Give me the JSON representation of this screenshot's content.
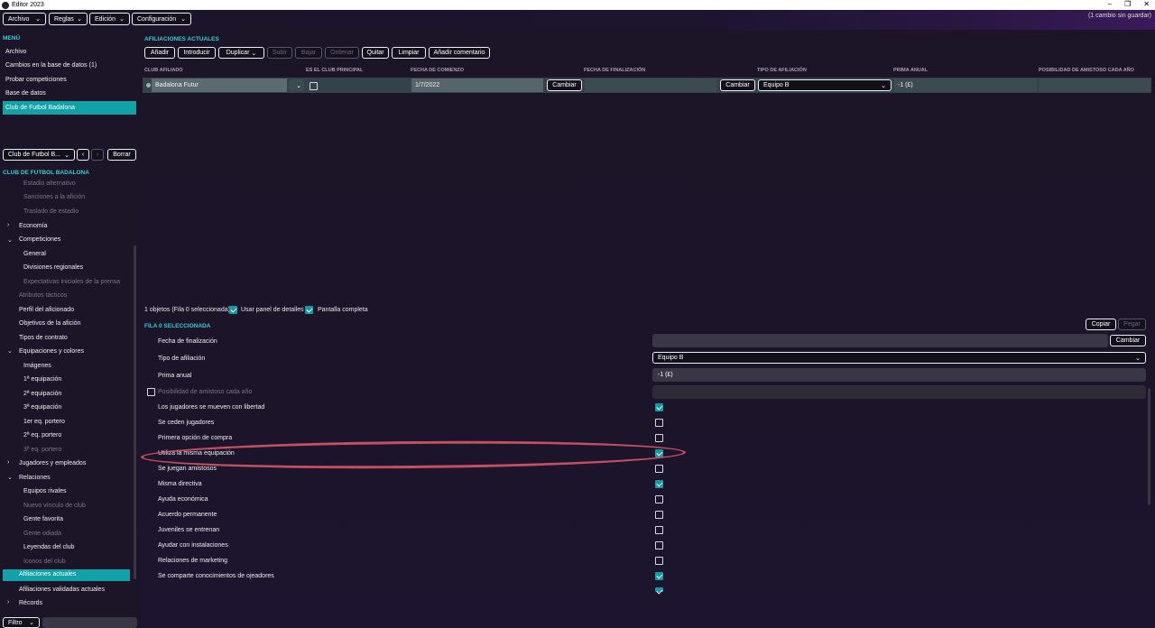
{
  "window": {
    "title": "Editor 2023",
    "controls": [
      "–",
      "❐",
      "✕"
    ]
  },
  "menubar": [
    {
      "label": "Archivo"
    },
    {
      "label": "Reglas"
    },
    {
      "label": "Edición"
    },
    {
      "label": "Configuración"
    }
  ],
  "unsaved": "(1 cambio sin guardar)",
  "left": {
    "menu_title": "MENÚ",
    "menu_items": [
      "Archivo",
      "Cambios en la base de datos (1)",
      "Probar competiciones",
      "Base de datos",
      "Club de Futbol Badalona"
    ],
    "selector": "Club de Futbol B...",
    "delete": "Borrar",
    "club_title": "CLUB DE FUTBOL BADALONA",
    "tree": [
      {
        "label": "Estadio alternativo",
        "dim": true
      },
      {
        "label": "Sanciones a la afición",
        "dim": true
      },
      {
        "label": "Traslado de estadio",
        "dim": true
      },
      {
        "label": "Economía"
      },
      {
        "label": "Competiciones"
      },
      {
        "label": "General"
      },
      {
        "label": "Divisiones regionales"
      },
      {
        "label": "Expectativas iniciales de la prensa",
        "dim": true
      },
      {
        "label": "Atributos tácticos",
        "dim": true
      },
      {
        "label": "Perfil del aficionado"
      },
      {
        "label": "Objetivos de la afición"
      },
      {
        "label": "Tipos de contrato"
      },
      {
        "label": "Equipaciones y colores"
      },
      {
        "label": "Imágenes"
      },
      {
        "label": "1ª equipación"
      },
      {
        "label": "2ª equipación"
      },
      {
        "label": "3ª equipación"
      },
      {
        "label": "1er eq. portero"
      },
      {
        "label": "2ª eq. portero"
      },
      {
        "label": "3ª eq. portero",
        "dim": true
      },
      {
        "label": "Jugadores y empleados"
      },
      {
        "label": "Relaciones"
      },
      {
        "label": "Equipos rivales"
      },
      {
        "label": "Nuevo vínculo de club",
        "dim": true
      },
      {
        "label": "Gente favorita"
      },
      {
        "label": "Gente odiada",
        "dim": true
      },
      {
        "label": "Leyendas del club"
      },
      {
        "label": "Iconos del club",
        "dim": true
      },
      {
        "label": "Afiliaciones actuales"
      },
      {
        "label": "Afiliaciones validadas actuales"
      },
      {
        "label": "Récords"
      }
    ],
    "filter": "Filtro"
  },
  "main": {
    "section_title": "AFILIACIONES ACTUALES",
    "toolbar": [
      "Añadir",
      "Introducir",
      "Duplicar",
      "Subir",
      "Bajar",
      "Ordenar",
      "Quitar",
      "Limpiar",
      "Añadir comentario"
    ],
    "columns": [
      "CLUB AFILIADO",
      "ES EL CLUB PRINCIPAL",
      "FECHA DE COMIENZO",
      "FECHA DE FINALIZACIÓN",
      "TIPO DE AFILIACIÓN",
      "PRIMA ANUAL",
      "POSIBILIDAD DE AMISTOSO CADA AÑO"
    ],
    "row": {
      "club": "Badalona Futur",
      "start": "1/7/2022",
      "change": "Cambiar",
      "change2": "Cambiar",
      "type": "Equipo B",
      "fee": "-1 (£)"
    },
    "status": "1 objetos (Fila 0 seleccionada)",
    "use_details": "Usar panel de detalles",
    "fullscreen": "Pantalla completa",
    "details_title": "FILA 0 SELECCIONADA",
    "copy": "Copiar",
    "paste": "Pegar",
    "details": {
      "end_date": "Fecha de finalización",
      "change": "Cambiar",
      "type_label": "Tipo de afiliación",
      "type_value": "Equipo B",
      "fee_label": "Prima anual",
      "fee_value": "-1 (£)",
      "friendly_label": "Posibilidad de amistoso cada año"
    },
    "checks": [
      {
        "label": "Los jugadores se mueven con libertad",
        "on": true
      },
      {
        "label": "Se ceden jugadores",
        "on": false
      },
      {
        "label": "Primera opción de compra",
        "on": false
      },
      {
        "label": "Utiliza la misma equipación",
        "on": true
      },
      {
        "label": "Se juegan amistosos",
        "on": false
      },
      {
        "label": "Misma directiva",
        "on": true
      },
      {
        "label": "Ayuda económica",
        "on": false
      },
      {
        "label": "Acuerdo permanente",
        "on": false
      },
      {
        "label": "Juveniles se entrenan",
        "on": false
      },
      {
        "label": "Ayudar con instalaciones",
        "on": false
      },
      {
        "label": "Relaciones de marketing",
        "on": false
      },
      {
        "label": "Se comparte conocimientos de ojeadores",
        "on": true
      }
    ]
  }
}
